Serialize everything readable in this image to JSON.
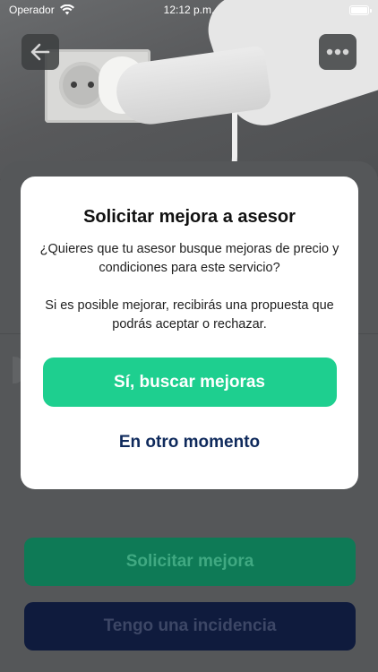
{
  "status_bar": {
    "carrier": "Operador",
    "time": "12:12 p.m."
  },
  "header": {
    "back_icon": "arrow-left-icon",
    "more_icon": "more-dots-icon"
  },
  "actions": {
    "request_improvement": "Solicitar mejora",
    "report_incident": "Tengo una incidencia"
  },
  "modal": {
    "title": "Solicitar mejora a asesor",
    "paragraph_1": "¿Quieres que tu asesor busque mejoras de precio y condiciones para este servicio?",
    "paragraph_2": "Si es posible mejorar, recibirás una propuesta que podrás aceptar o rechazar.",
    "confirm_label": "Sí, buscar mejoras",
    "cancel_label": "En otro momento"
  },
  "colors": {
    "accent_green": "#1ecf8f",
    "navy": "#0f2a5c"
  }
}
